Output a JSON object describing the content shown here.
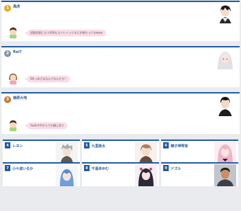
{
  "ranking": [
    {
      "rank": "1",
      "name": "異虎"
    },
    {
      "rank": "2",
      "name": "Rei7"
    },
    {
      "rank": "3",
      "name": "條原大地"
    }
  ],
  "comments": [
    {
      "text": "初配信前にもう400もストレイってるとか終わってるwww"
    },
    {
      "text": "Ditっぽさはなんでなんだろ？"
    },
    {
      "text": "Switch今からでも間に合う"
    }
  ],
  "grid": [
    {
      "rank": "4",
      "name": "レヨン"
    },
    {
      "rank": "5",
      "name": "九里詠太"
    },
    {
      "rank": "6",
      "name": "御子神琴音"
    },
    {
      "rank": "7",
      "name": "小々波いるか"
    },
    {
      "rank": "8",
      "name": "千遥あゆむ"
    },
    {
      "rank": "9",
      "name": "ドズル"
    }
  ]
}
